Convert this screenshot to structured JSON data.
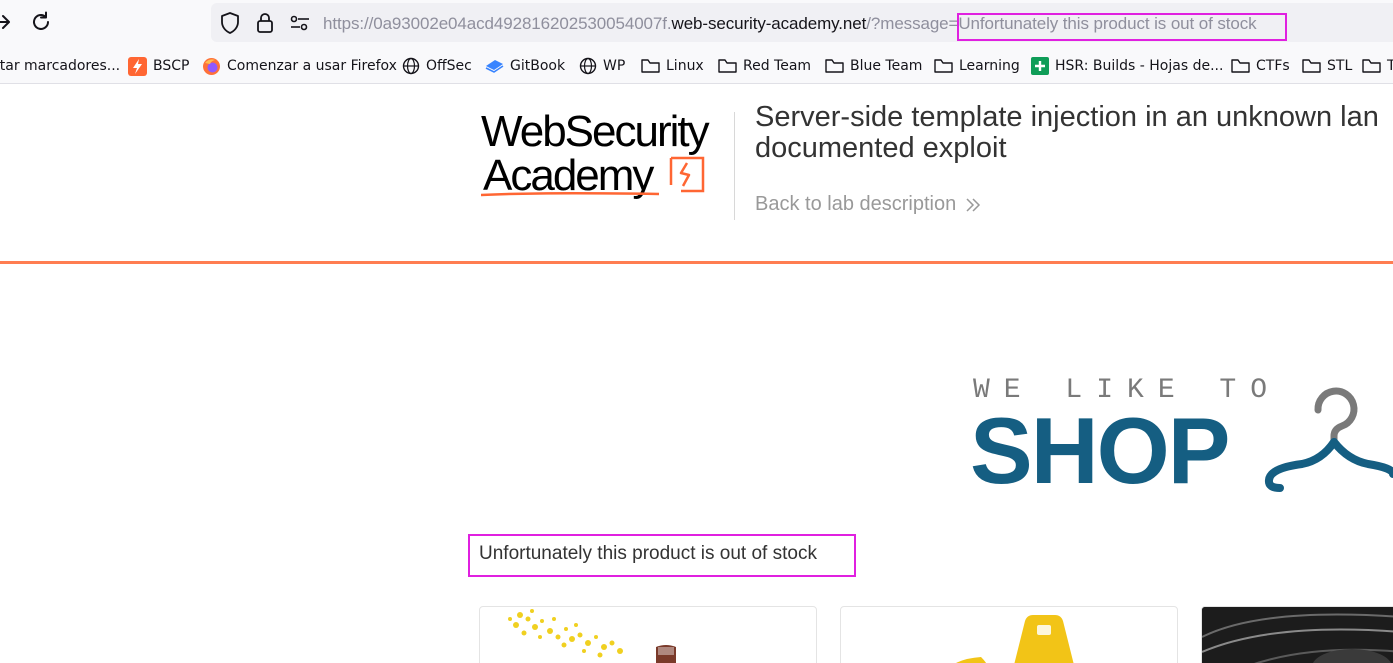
{
  "browser": {
    "url_prefix": "https://0a93002e04acd492816202530054007f.",
    "url_domain": "web-security-academy.net",
    "url_path": "/?message",
    "url_query_value": "=Unfortunately this product is out of stock",
    "bookmarks": [
      {
        "label": "rtar marcadores...",
        "icon": "none"
      },
      {
        "label": "BSCP",
        "icon": "bscp-icon"
      },
      {
        "label": "Comenzar a usar Firefox",
        "icon": "firefox-icon"
      },
      {
        "label": "OffSec",
        "icon": "globe-icon"
      },
      {
        "label": "GitBook",
        "icon": "gitbook-icon"
      },
      {
        "label": "WP",
        "icon": "globe-icon"
      },
      {
        "label": "Linux",
        "icon": "folder-icon"
      },
      {
        "label": "Red Team",
        "icon": "folder-icon"
      },
      {
        "label": "Blue Team",
        "icon": "folder-icon"
      },
      {
        "label": "Learning",
        "icon": "folder-icon"
      },
      {
        "label": "HSR: Builds - Hojas de...",
        "icon": "sheets-icon"
      },
      {
        "label": "CTFs",
        "icon": "folder-icon"
      },
      {
        "label": "STL",
        "icon": "folder-icon"
      },
      {
        "label": "T",
        "icon": "folder-icon"
      }
    ]
  },
  "lab": {
    "logo_line1": "WebSecurity",
    "logo_line2": "Academy",
    "title_line1": "Server-side template injection in an unknown lan",
    "title_line2": "documented exploit",
    "back_link": "Back to lab description"
  },
  "shop": {
    "tagline": "WE LIKE TO",
    "word": "SHOP",
    "message": "Unfortunately this product is out of stock"
  },
  "colors": {
    "accent_orange": "#ff6633",
    "shop_blue": "#155e82",
    "highlight_magenta": "#e020e0"
  }
}
